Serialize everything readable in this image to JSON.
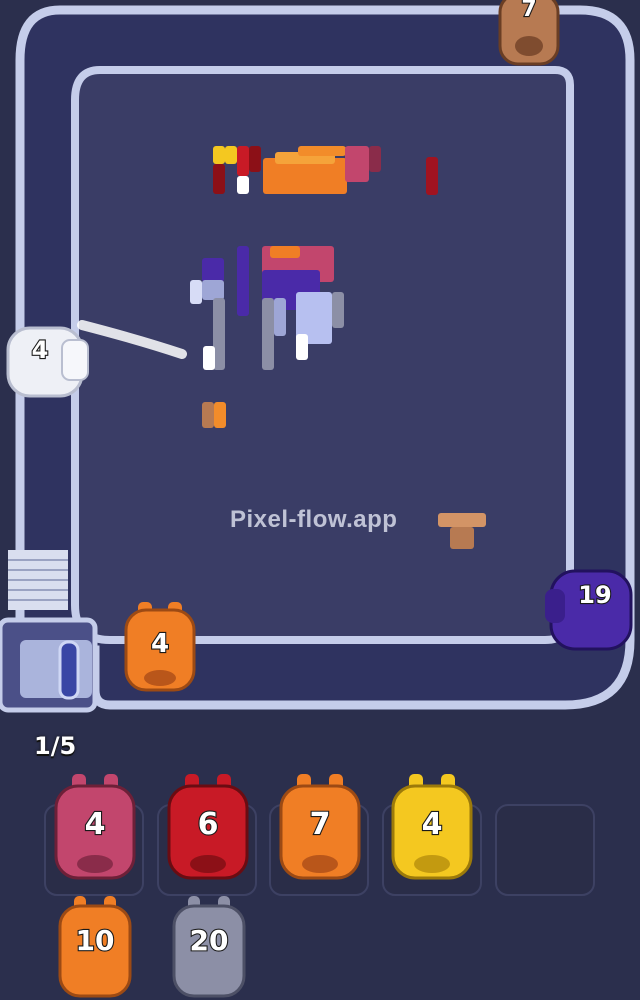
{
  "watermark": "Pixel-flow.app",
  "progress": "1/5",
  "track": {
    "conveyor_pigs": [
      {
        "id": "pig-top-brown",
        "count": "7",
        "color": "#b77a52",
        "dark": "#7f4c2f"
      },
      {
        "id": "pig-left-white",
        "count": "4",
        "color": "#eef0f6",
        "dark": "#c3c7d6"
      },
      {
        "id": "pig-right-purple",
        "count": "19",
        "color": "#4a2aa8",
        "dark": "#2f1a78"
      },
      {
        "id": "pig-bottom-orange",
        "count": "4",
        "color": "#f07e25",
        "dark": "#b9561a"
      }
    ]
  },
  "queue": {
    "row1": [
      {
        "count": "4",
        "color": "#c2466d",
        "dark": "#8a2c4a"
      },
      {
        "count": "6",
        "color": "#c81a26",
        "dark": "#8c1017"
      },
      {
        "count": "7",
        "color": "#f07e25",
        "dark": "#b9561a"
      },
      {
        "count": "4",
        "color": "#f4c820",
        "dark": "#c39a10"
      },
      {
        "count": "",
        "color": "",
        "dark": ""
      }
    ],
    "row2": [
      {
        "count": "10",
        "color": "#f07e25",
        "dark": "#b9561a"
      },
      {
        "count": "20",
        "color": "#8c8fa6",
        "dark": "#5d6078"
      }
    ]
  },
  "colors": {
    "background": "#2b2f4d",
    "board": "#3a3d66",
    "track": "#c9d0ea"
  }
}
